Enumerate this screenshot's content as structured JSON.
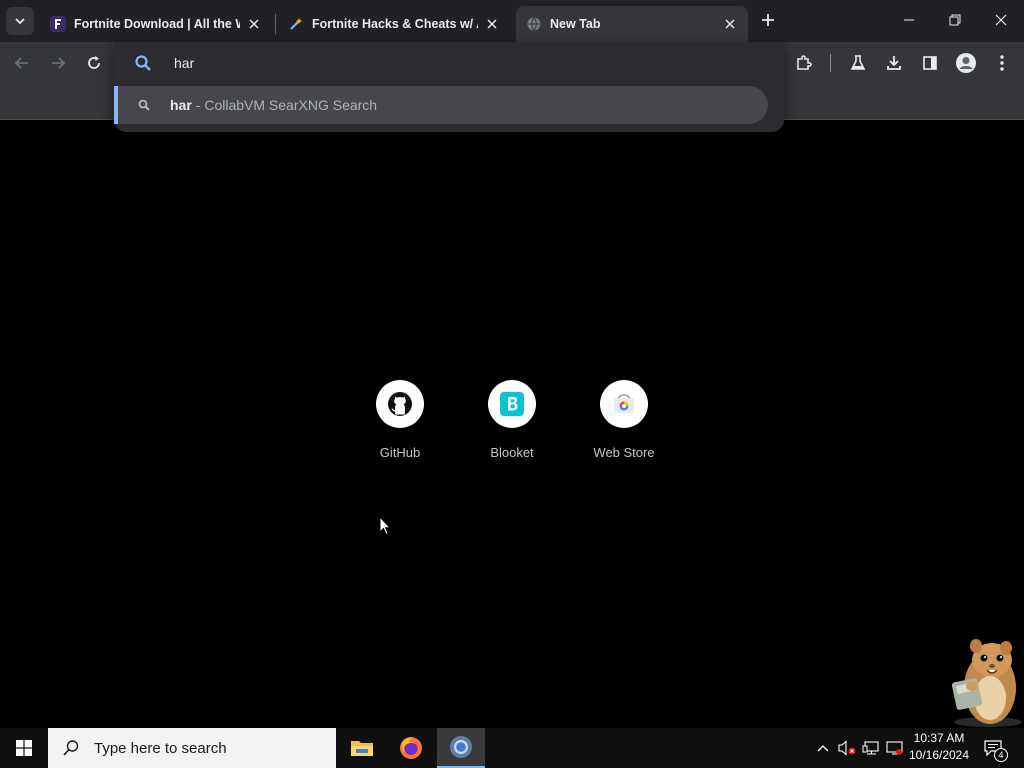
{
  "browser": {
    "tabs": [
      {
        "title": "Fortnite Download | All the Wa",
        "active": false
      },
      {
        "title": "Fortnite Hacks & Cheats w/ Ai",
        "active": false
      },
      {
        "title": "New Tab",
        "active": true
      }
    ]
  },
  "omnibox": {
    "query": "har",
    "suggestion": {
      "query": "har",
      "description": "- CollabVM SearXNG Search"
    }
  },
  "shortcuts": [
    {
      "label": "GitHub",
      "icon": "github-icon"
    },
    {
      "label": "Blooket",
      "icon": "blooket-icon"
    },
    {
      "label": "Web Store",
      "icon": "web-store-icon"
    }
  ],
  "taskbar": {
    "search_placeholder": "Type here to search",
    "time": "10:37 AM",
    "date": "10/16/2024",
    "notification_count": "4"
  },
  "colors": {
    "accent": "#8ab4f8",
    "blooket": "#0bc2cf",
    "taskbar_highlight": "#76b9ed"
  }
}
